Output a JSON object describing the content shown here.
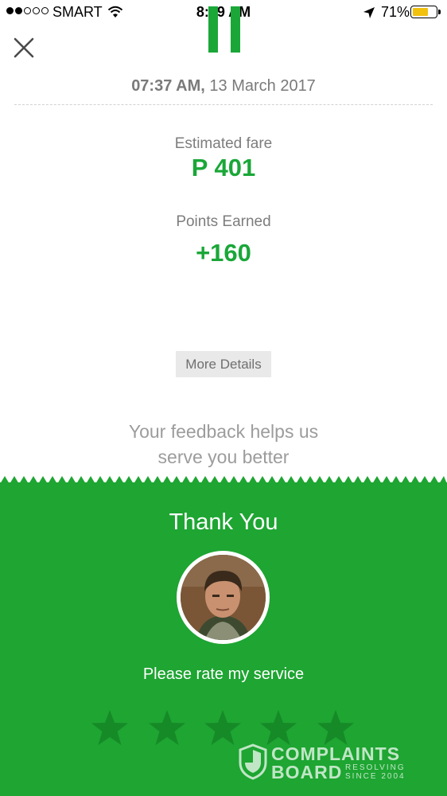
{
  "status_bar": {
    "signal_bars_filled": 2,
    "signal_bars_total": 5,
    "carrier": "SMART",
    "time": "8:09 AM",
    "battery_percent": "71%",
    "battery_level": 0.71
  },
  "header": {
    "close_icon": "close-icon",
    "brand_color": "#1aa738"
  },
  "trip": {
    "time": "07:37 AM,",
    "date": "13 March 2017"
  },
  "fare": {
    "label": "Estimated fare",
    "value": "P 401"
  },
  "points": {
    "label": "Points Earned",
    "value": "+160"
  },
  "more_details_label": "More Details",
  "feedback": {
    "line1": "Your feedback helps us",
    "line2": "serve you better"
  },
  "rating_panel": {
    "background_color": "#1ea532",
    "title": "Thank You",
    "prompt": "Please rate my service",
    "stars_total": 5,
    "stars_selected": 0
  },
  "watermark": {
    "line1": "COMPLAINTS",
    "line2": "BOARD",
    "tag1": "RESOLVING",
    "tag2": "SINCE 2004"
  }
}
